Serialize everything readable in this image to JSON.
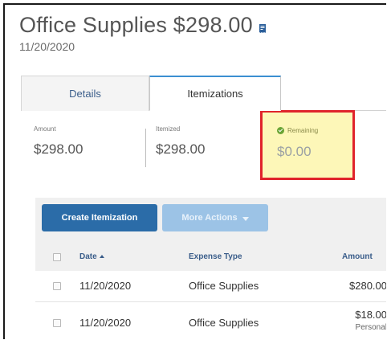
{
  "header": {
    "title": "Office Supplies $298.00",
    "date": "11/20/2020",
    "receipt_icon": "receipt-icon"
  },
  "tabs": [
    {
      "label": "Details",
      "active": false
    },
    {
      "label": "Itemizations",
      "active": true
    }
  ],
  "summary": {
    "amount": {
      "label": "Amount",
      "value": "$298.00"
    },
    "itemized": {
      "label": "Itemized",
      "value": "$298.00"
    },
    "remaining": {
      "label": "Remaining",
      "value": "$0.00",
      "status_icon": "check-circle-icon"
    }
  },
  "toolbar": {
    "create_label": "Create Itemization",
    "more_label": "More Actions"
  },
  "table": {
    "columns": [
      "Date",
      "Expense Type",
      "Amount"
    ],
    "rows": [
      {
        "date": "11/20/2020",
        "expense_type": "Office Supplies",
        "amount": "$280.00",
        "note": ""
      },
      {
        "date": "11/20/2020",
        "expense_type": "Office Supplies",
        "amount": "$18.00",
        "note": "Personal"
      }
    ]
  },
  "colors": {
    "primary_button": "#2b6ca8",
    "disabled_button": "#9cc3e6",
    "highlight_border": "#e0242c",
    "highlight_fill": "#fdf7b8",
    "active_tab_accent": "#3b8fd1",
    "status_ok": "#6aa436"
  }
}
